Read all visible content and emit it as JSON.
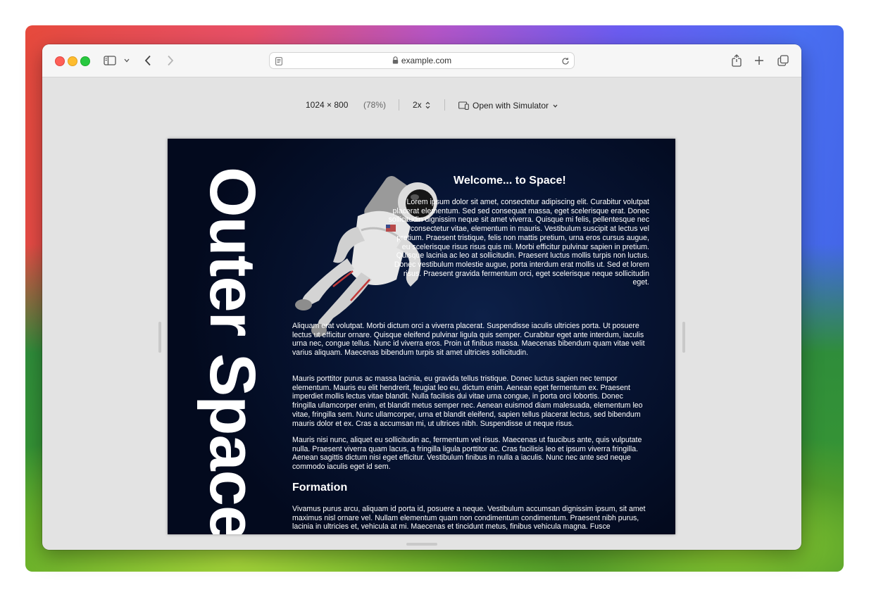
{
  "browser": {
    "url": "example.com"
  },
  "responsive_bar": {
    "dimensions": "1024 × 800",
    "zoom": "(78%)",
    "scale": "2x",
    "simulator": "Open with Simulator"
  },
  "page": {
    "vertical_title": "Outer Space",
    "heading": "Welcome... to Space!",
    "paragraphs": [
      "Lorem ipsum dolor sit amet, consectetur adipiscing elit. Curabitur volutpat placerat elementum. Sed sed consequat massa, eget scelerisque erat. Donec sollicitudin dignissim neque sit amet viverra. Quisque mi felis, pellentesque nec consectetur vitae, elementum in mauris. Vestibulum suscipit at lectus vel pretium. Praesent tristique, felis non mattis pretium, urna eros cursus augue, eu scelerisque risus risus quis mi. Morbi efficitur pulvinar sapien in pretium. Quisque lacinia ac leo at sollicitudin. Praesent luctus mollis turpis non luctus. Donec vestibulum molestie augue, porta interdum erat mollis ut. Sed et lorem risus. Praesent gravida fermentum orci, eget scelerisque neque sollicitudin eget.",
      "Aliquam erat volutpat. Morbi dictum orci a viverra placerat. Suspendisse iaculis ultricies porta. Ut posuere lectus ut efficitur ornare. Quisque eleifend pulvinar ligula quis semper. Curabitur eget ante interdum, iaculis urna nec, congue tellus. Nunc id viverra eros. Proin ut finibus massa. Maecenas bibendum quam vitae velit varius aliquam. Maecenas bibendum turpis sit amet ultricies sollicitudin.",
      "Mauris porttitor purus ac massa lacinia, eu gravida tellus tristique. Donec luctus sapien nec tempor elementum. Mauris eu elit hendrerit, feugiat leo eu, dictum enim. Aenean eget fermentum ex. Praesent imperdiet mollis lectus vitae blandit. Nulla facilisis dui vitae urna congue, in porta orci lobortis. Donec fringilla ullamcorper enim, et blandit metus semper nec. Aenean euismod diam malesuada, elementum leo vitae, fringilla sem. Nunc ullamcorper, urna et blandit eleifend, sapien tellus placerat lectus, sed bibendum mauris dolor et ex. Cras a accumsan mi, ut ultrices nibh. Suspendisse ut neque risus.",
      "Mauris nisi nunc, aliquet eu sollicitudin ac, fermentum vel risus. Maecenas ut faucibus ante, quis vulputate nulla. Praesent viverra quam lacus, a fringilla ligula porttitor ac. Cras facilisis leo et ipsum viverra fringilla. Aenean sagittis dictum nisi eget efficitur. Vestibulum finibus in nulla a iaculis. Nunc nec ante sed neque commodo iaculis eget id sem."
    ],
    "section_heading": "Formation",
    "section_paragraph": "Vivamus purus arcu, aliquam id porta id, posuere a neque. Vestibulum accumsan dignissim ipsum, sit amet maximus nisl ornare vel. Nullam elementum quam non condimentum condimentum. Praesent nibh purus, lacinia in ultricies et, vehicula at mi. Maecenas et tincidunt metus, finibus vehicula magna. Fusce"
  }
}
